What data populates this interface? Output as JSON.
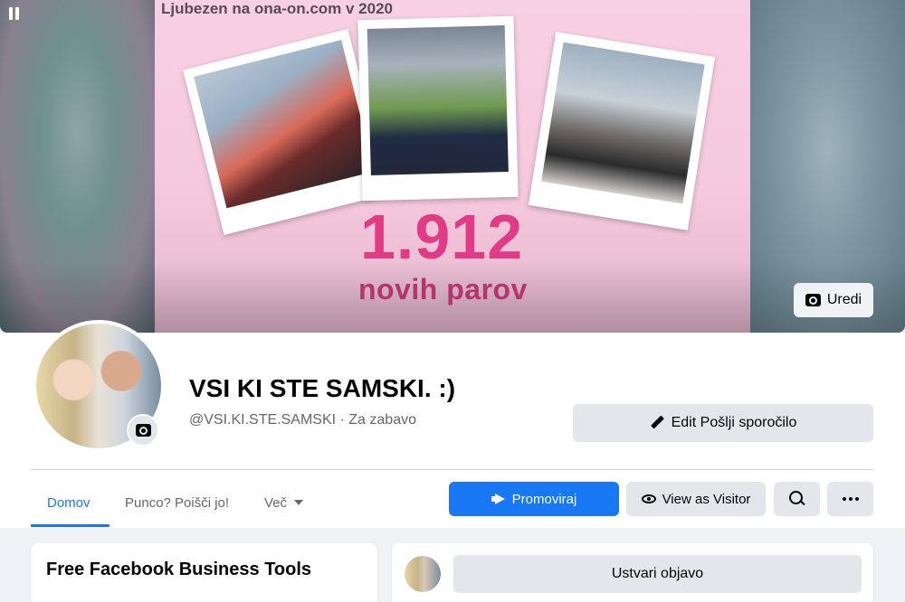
{
  "cover": {
    "caption": "Ljubezen na ona-on.com v 2020",
    "number": "1.912",
    "subtitle": "novih parov",
    "edit_label": "Uredi"
  },
  "profile": {
    "name": "VSI KI STE SAMSKI. :)",
    "handle": "@VSI.KI.STE.SAMSKI · Za zabavo"
  },
  "actions": {
    "send_message": "Edit Pošlji sporočilo",
    "promote": "Promoviraj",
    "view_as_visitor": "View as Visitor"
  },
  "tabs": [
    {
      "label": "Domov",
      "active": true
    },
    {
      "label": "Punco? Poišči jo!",
      "active": false
    },
    {
      "label": "Več",
      "active": false
    }
  ],
  "cards": {
    "left_title": "Free Facebook Business Tools",
    "create_post": "Ustvari objavo"
  },
  "colors": {
    "accent": "#1877f2",
    "number_pink": "#e03b84"
  }
}
